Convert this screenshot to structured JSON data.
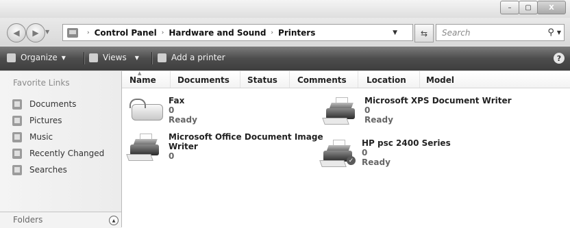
{
  "titlebar": {
    "minimize_glyph": "–",
    "maximize_glyph": "▢",
    "close_glyph": "X"
  },
  "address": {
    "icon": "control-panel-icon",
    "crumbs": [
      "Control Panel",
      "Hardware and Sound",
      "Printers"
    ],
    "separator": "›",
    "search_placeholder": "Search"
  },
  "toolbar": {
    "organize_label": "Organize",
    "views_label": "Views",
    "add_printer_label": "Add a printer",
    "help_glyph": "?"
  },
  "navpane": {
    "heading": "Favorite Links",
    "items": [
      {
        "label": "Documents",
        "icon": "documents-icon"
      },
      {
        "label": "Pictures",
        "icon": "pictures-icon"
      },
      {
        "label": "Music",
        "icon": "music-icon"
      },
      {
        "label": "Recently Changed",
        "icon": "recently-changed-icon"
      },
      {
        "label": "Searches",
        "icon": "searches-icon"
      }
    ],
    "folders_label": "Folders"
  },
  "columns": [
    "Name",
    "Documents",
    "Status",
    "Comments",
    "Location",
    "Model"
  ],
  "printers": [
    {
      "name": "Fax",
      "documents": "0",
      "status": "Ready",
      "icon": "fax-icon"
    },
    {
      "name": "Microsoft XPS Document Writer",
      "documents": "0",
      "status": "Ready",
      "icon": "printer-icon"
    },
    {
      "name_line1": "Microsoft Office Document Image",
      "name_line2": "Writer",
      "documents": "0",
      "status": "",
      "icon": "printer-icon"
    },
    {
      "name": "HP psc 2400 Series",
      "documents": "0",
      "status": "Ready",
      "icon": "default-printer-icon"
    }
  ]
}
